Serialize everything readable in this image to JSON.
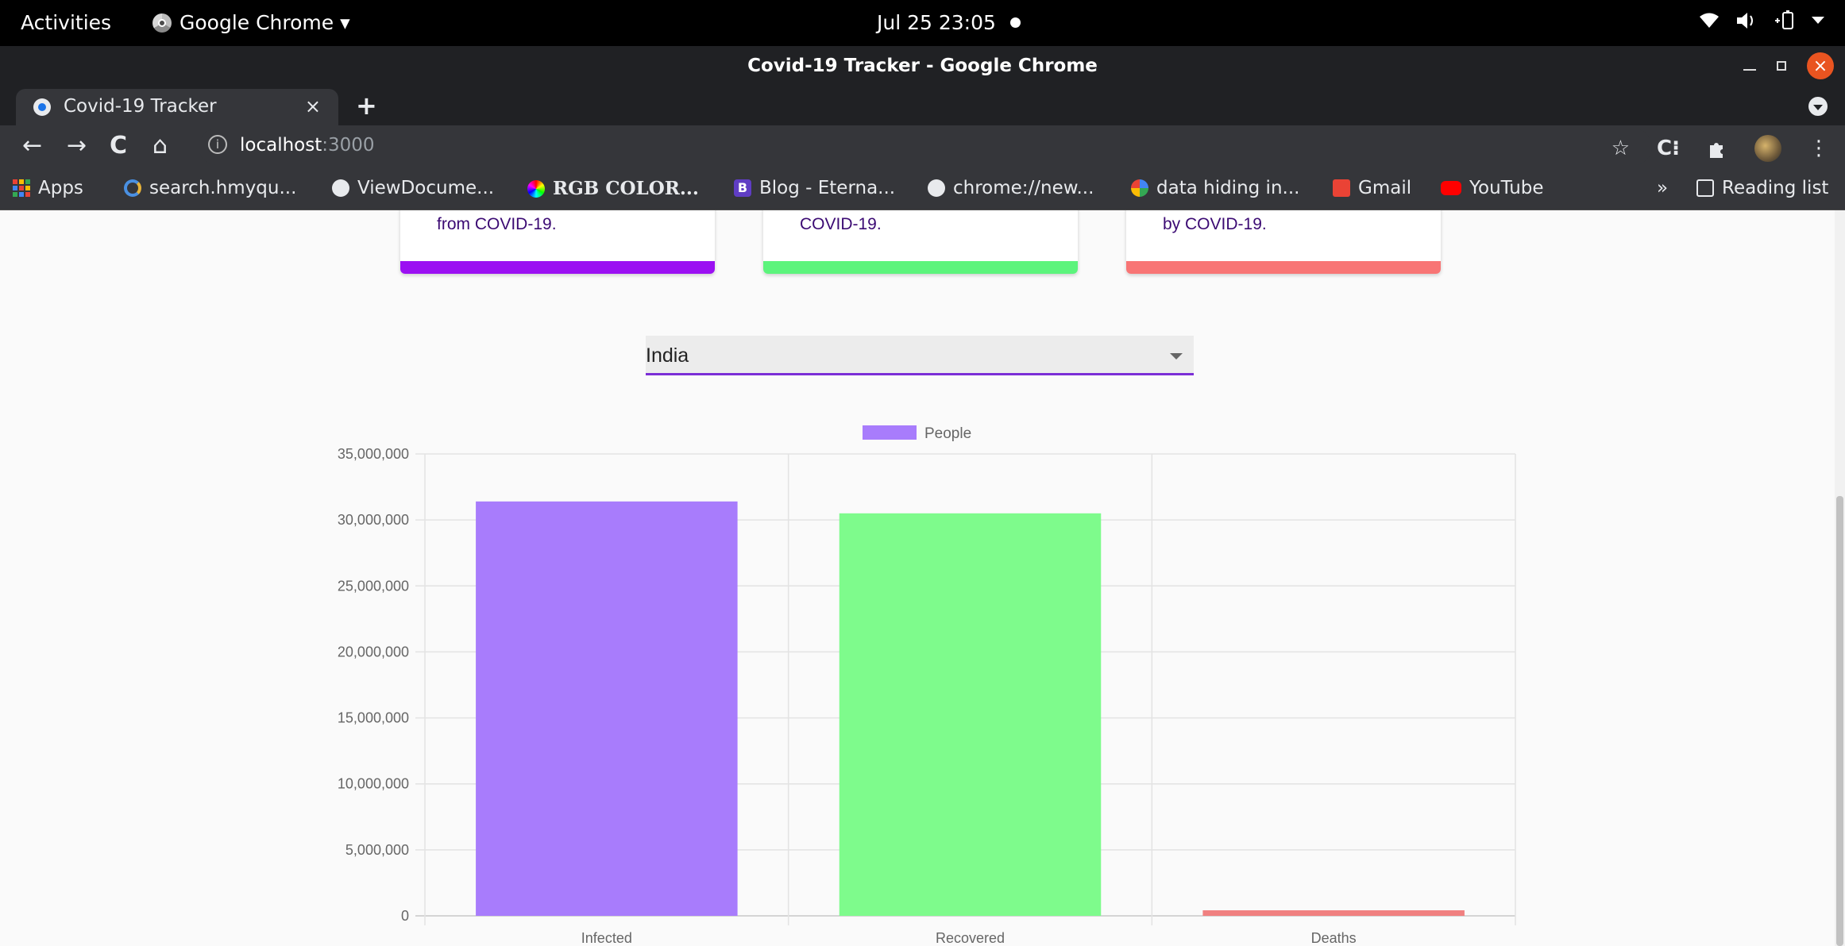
{
  "topbar": {
    "activities": "Activities",
    "app_name": "Google Chrome ▾",
    "clock": "Jul 25  23:05"
  },
  "window": {
    "title": "Covid-19 Tracker - Google Chrome"
  },
  "tab": {
    "label": "Covid-19 Tracker",
    "close": "×",
    "new_tab": "+"
  },
  "address": {
    "host": "localhost",
    "port": ":3000"
  },
  "bookmarks": [
    {
      "label": "Apps",
      "icon": "apps-grid-icon"
    },
    {
      "label": "search.hmyqu...",
      "icon": "spinner-icon"
    },
    {
      "label": "ViewDocume...",
      "icon": "globe-icon"
    },
    {
      "label": "RGB COLOR...",
      "icon": "rgb-icon"
    },
    {
      "label": "Blog - Eterna...",
      "icon": "blogger-icon"
    },
    {
      "label": "chrome://new...",
      "icon": "globe-icon"
    },
    {
      "label": "data hiding in...",
      "icon": "google-icon"
    },
    {
      "label": "Gmail",
      "icon": "gmail-icon"
    },
    {
      "label": "YouTube",
      "icon": "youtube-icon"
    }
  ],
  "bookmarks_more": "»",
  "reading_list": "Reading list",
  "cards": [
    {
      "text": "from COVID-19.",
      "color": "#9b10f2"
    },
    {
      "text": "COVID-19.",
      "color": "#5cf47c"
    },
    {
      "text": "by COVID-19.",
      "color": "#f87575"
    }
  ],
  "country_select": {
    "value": "India"
  },
  "chart_data": {
    "type": "bar",
    "categories": [
      "Infected",
      "Recovered",
      "Deaths"
    ],
    "series": [
      {
        "name": "People",
        "values": [
          31400000,
          30500000,
          420000
        ],
        "colors": [
          "#a87cfc",
          "#7efb8c",
          "#f08080"
        ]
      }
    ],
    "ylim": [
      0,
      35000000
    ],
    "yticks": [
      "0",
      "5,000,000",
      "10,000,000",
      "15,000,000",
      "20,000,000",
      "25,000,000",
      "30,000,000",
      "35,000,000"
    ],
    "grid": true,
    "legend": "top-center"
  }
}
